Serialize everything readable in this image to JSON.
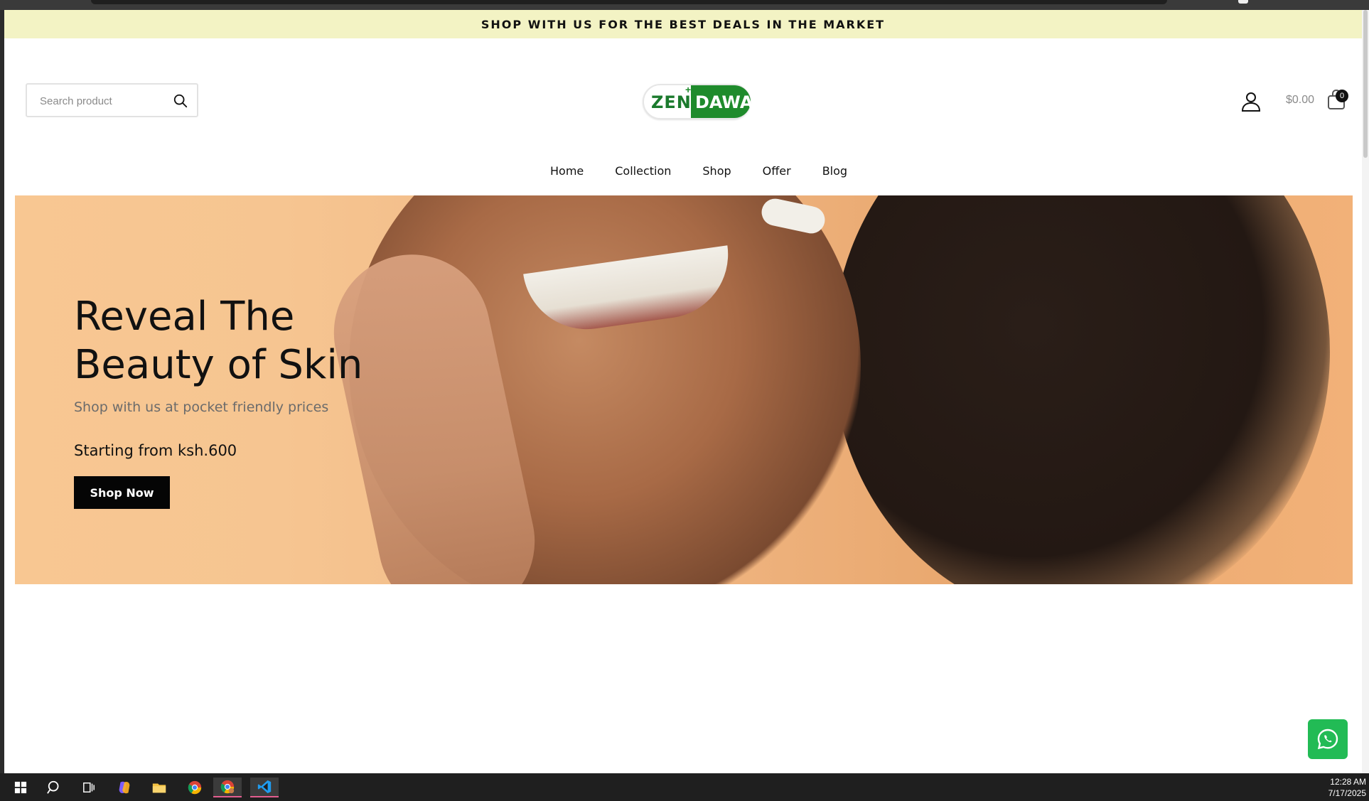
{
  "announcement": "SHOP WITH US FOR THE BEST DEALS IN THE MARKET",
  "search": {
    "placeholder": "Search product"
  },
  "logo": {
    "part1": "ZEN",
    "part2": "DAWA"
  },
  "header": {
    "cart_total": "$0.00",
    "cart_count": "0"
  },
  "nav": {
    "items": [
      "Home",
      "Collection",
      "Shop",
      "Offer",
      "Blog"
    ]
  },
  "hero": {
    "title_line1": "Reveal The",
    "title_line2": "Beauty of Skin",
    "subtitle": "Shop with us at pocket friendly prices",
    "price": "Starting from ksh.600",
    "button": "Shop Now"
  },
  "taskbar": {
    "time": "12:28 AM",
    "date": "7/17/2025"
  },
  "colors": {
    "announcement_bg": "#f3f3c4",
    "brand_green": "#1f8b2c",
    "whatsapp_green": "#22bb55",
    "hero_bg": "#f6c591"
  }
}
